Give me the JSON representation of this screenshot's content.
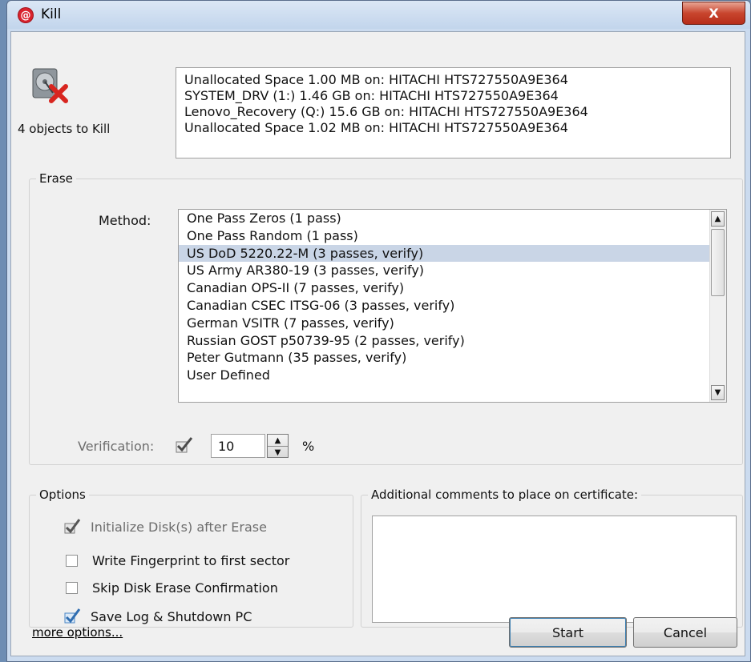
{
  "window": {
    "title": "Kill",
    "close_label": "X"
  },
  "objects": {
    "count_label": "4 objects to Kill",
    "items": [
      "Unallocated Space 1.00 MB on: HITACHI HTS727550A9E364",
      "SYSTEM_DRV (1:) 1.46 GB on: HITACHI HTS727550A9E364",
      "Lenovo_Recovery (Q:) 15.6 GB on: HITACHI HTS727550A9E364",
      "Unallocated Space 1.02 MB on: HITACHI HTS727550A9E364"
    ]
  },
  "erase": {
    "group_title": "Erase",
    "method_label": "Method:",
    "methods": [
      "One Pass Zeros (1 pass)",
      "One Pass Random (1 pass)",
      "US DoD 5220.22-M (3 passes, verify)",
      "US Army AR380-19 (3 passes, verify)",
      "Canadian OPS-II (7 passes, verify)",
      "Canadian CSEC ITSG-06 (3 passes, verify)",
      "German VSITR (7 passes, verify)",
      "Russian GOST p50739-95 (2 passes, verify)",
      "Peter Gutmann (35 passes, verify)",
      "User Defined"
    ],
    "selected_method": "US DoD 5220.22-M (3 passes, verify)",
    "verification_label": "Verification:",
    "verification_checked": true,
    "verification_value": "10",
    "percent_label": "%"
  },
  "options": {
    "group_title": "Options",
    "items": [
      {
        "label": "Initialize Disk(s) after Erase",
        "checked": true,
        "enabled": false
      },
      {
        "label": "Write Fingerprint to first sector",
        "checked": false,
        "enabled": true
      },
      {
        "label": "Skip Disk Erase Confirmation",
        "checked": false,
        "enabled": true
      },
      {
        "label": "Save Log & Shutdown PC",
        "checked": true,
        "enabled": true
      }
    ]
  },
  "comments": {
    "group_title": "Additional comments to place on certificate:",
    "value": ""
  },
  "footer": {
    "more_options": "more options...",
    "start": "Start",
    "cancel": "Cancel"
  },
  "colors": {
    "selection": "#c9d5e6",
    "close_button": "#c8452e",
    "app_icon": "#d9232d"
  }
}
